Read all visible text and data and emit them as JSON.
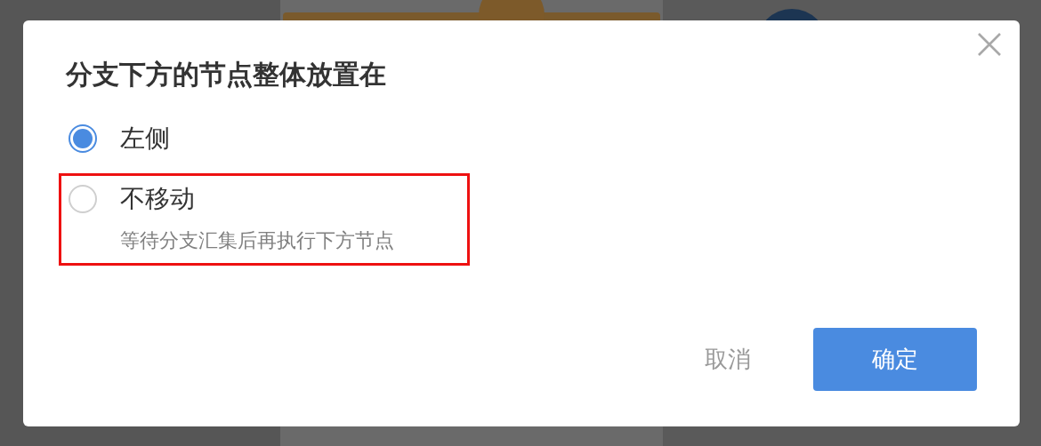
{
  "dialog": {
    "title": "分支下方的节点整体放置在",
    "options": [
      {
        "label": "左侧",
        "selected": true,
        "highlighted": false
      },
      {
        "label": "不移动",
        "description": "等待分支汇集后再执行下方节点",
        "selected": false,
        "highlighted": true
      }
    ],
    "buttons": [
      {
        "label": "取消",
        "kind": "text"
      },
      {
        "label": "确定",
        "kind": "primary"
      }
    ]
  }
}
